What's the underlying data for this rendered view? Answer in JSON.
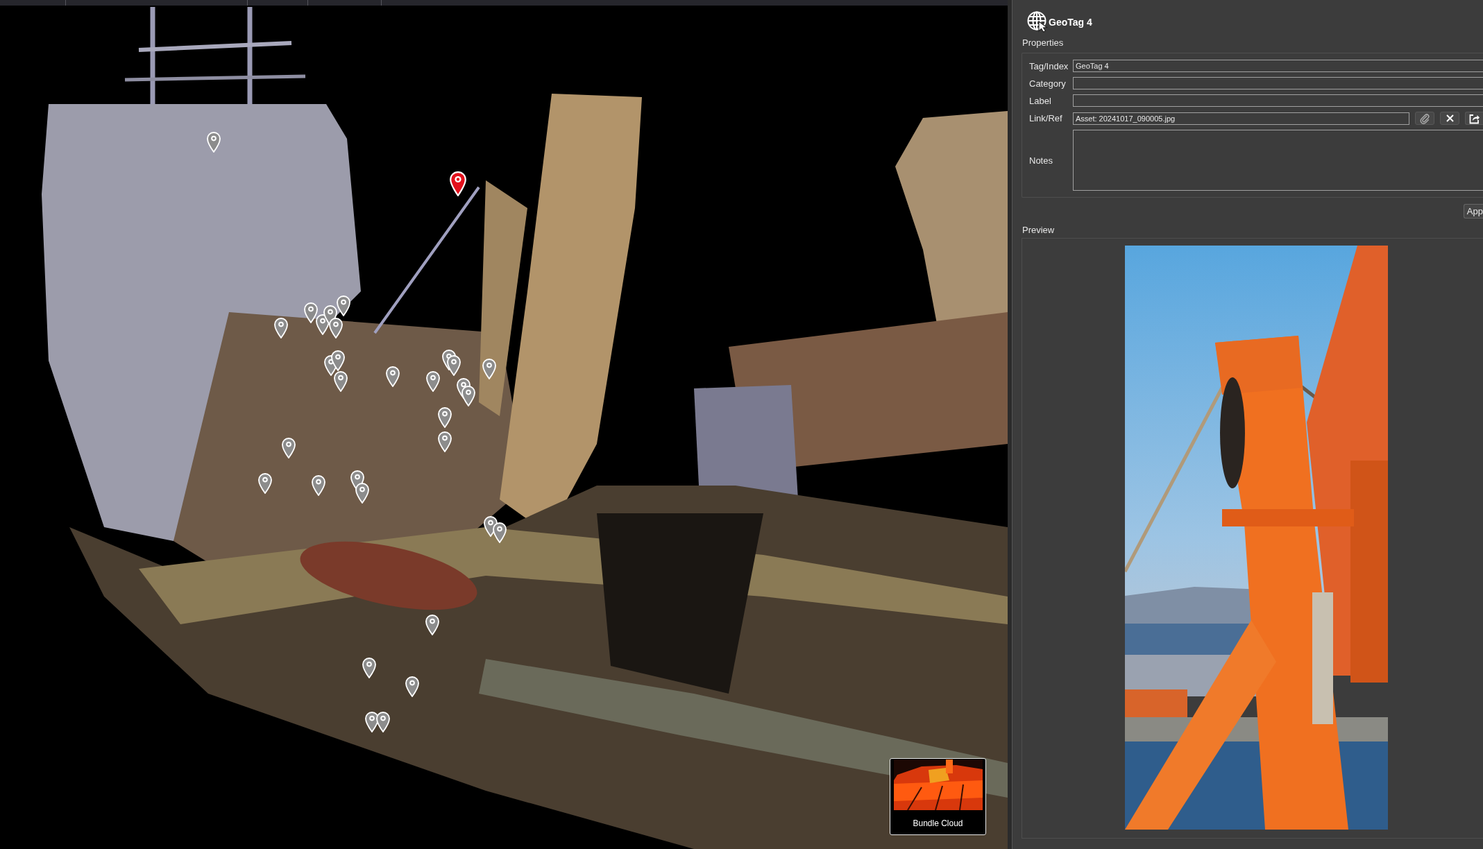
{
  "viewport": {
    "geotags": [
      {
        "selected": false
      },
      {
        "selected": true
      },
      {
        "selected": false
      },
      {
        "selected": false
      },
      {
        "selected": false
      },
      {
        "selected": false
      },
      {
        "selected": false
      },
      {
        "selected": false
      },
      {
        "selected": false
      },
      {
        "selected": false
      },
      {
        "selected": false
      },
      {
        "selected": false
      },
      {
        "selected": false
      },
      {
        "selected": false
      },
      {
        "selected": false
      },
      {
        "selected": false
      },
      {
        "selected": false
      },
      {
        "selected": false
      },
      {
        "selected": false
      },
      {
        "selected": false
      },
      {
        "selected": false
      },
      {
        "selected": false
      },
      {
        "selected": false
      },
      {
        "selected": false
      },
      {
        "selected": false
      },
      {
        "selected": false
      },
      {
        "selected": false
      },
      {
        "selected": false
      },
      {
        "selected": false
      },
      {
        "selected": false
      },
      {
        "selected": false
      },
      {
        "selected": false
      }
    ],
    "overlay_card": {
      "label": "Bundle Cloud"
    }
  },
  "panel": {
    "title": "GeoTag 4",
    "properties": {
      "title": "Properties",
      "fields": [
        {
          "kind": "text",
          "label": "Tag/Index",
          "value": "GeoTag 4"
        },
        {
          "kind": "text",
          "label": "Category"
        },
        {
          "kind": "text",
          "label": "Label"
        },
        {
          "kind": "link",
          "label": "Link/Ref",
          "value": "Asset: 20241017_090005.jpg"
        },
        {
          "kind": "multiline",
          "label": "Notes"
        }
      ]
    },
    "apply_button": {
      "label": "App"
    },
    "preview": {
      "title": "Preview"
    }
  }
}
